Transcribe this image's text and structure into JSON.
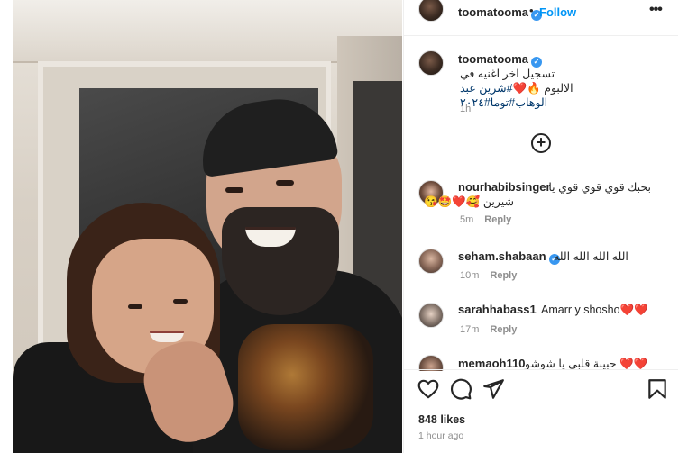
{
  "post": {
    "author": "toomatooma",
    "follow_label": "Follow",
    "dot": "•",
    "more": "•••",
    "caption_line1": "تسجيل اخر اغنيه في",
    "caption_line2_prefix": "الالبوم",
    "caption_line2_emoji": "🔥❤️",
    "caption_line2_tag": "#شرين عبد",
    "caption_line3_tag": "الوهاب#توما#٢٠٢٤",
    "caption_time": "1h",
    "add_comment_icon": "plus-circle-icon"
  },
  "comments": [
    {
      "user": "nourhabibsinger",
      "text_line1": "بحبك قوي قوي قوي يا",
      "text_line2": "شيرين 🥰❤️🤩😘",
      "time": "5m",
      "reply": "Reply",
      "verified": false
    },
    {
      "user": "seham.shabaan",
      "text_line1": "الله الله الله الله",
      "time": "10m",
      "reply": "Reply",
      "verified": true
    },
    {
      "user": "sarahhabass1",
      "text_line1": "Amarr y shosho❤️❤️",
      "time": "17m",
      "reply": "Reply",
      "verified": false
    },
    {
      "user": "memaoh110",
      "text_line1": "❤️❤️ حبيبة قلبي يا شوشو",
      "verified": false
    }
  ],
  "actions": {
    "like_icon": "heart-icon",
    "comment_icon": "comment-icon",
    "share_icon": "send-icon",
    "save_icon": "bookmark-icon",
    "likes": "848 likes",
    "posted": "1 hour ago"
  },
  "colors": {
    "verified": "#3897f0",
    "follow": "#0095f6",
    "hashtag": "#00376b",
    "muted": "#8e8e8e"
  }
}
